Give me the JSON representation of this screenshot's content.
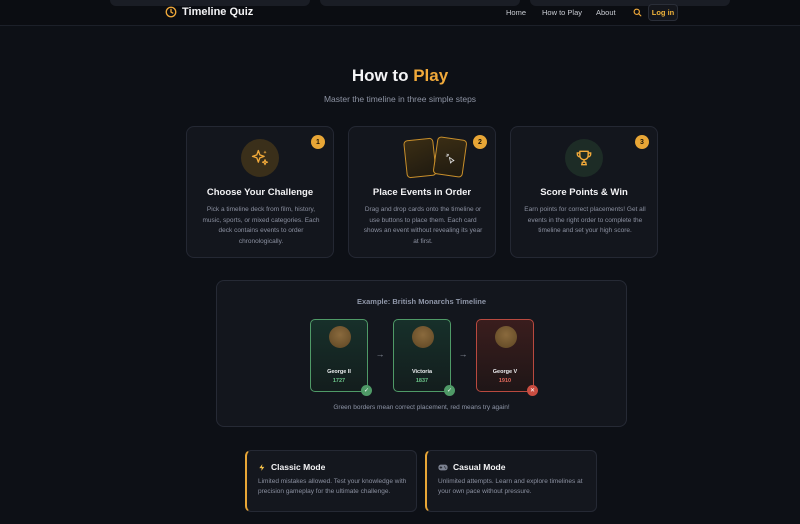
{
  "nav": {
    "brand": "Timeline Quiz",
    "links": [
      "Home",
      "How to Play",
      "About"
    ],
    "login": "Log in"
  },
  "hero": {
    "title_part1": "How to",
    "title_part2": "Play",
    "subtitle": "Master the timeline in three simple steps"
  },
  "steps": [
    {
      "number": "1",
      "icon": "sparkles-icon",
      "title": "Choose Your Challenge",
      "description": "Pick a timeline deck from film, history, music, sports, or mixed categories. Each deck contains events to order chronologically."
    },
    {
      "number": "2",
      "icon": "cards-icon",
      "title": "Place Events in Order",
      "description": "Drag and drop cards onto the timeline or use buttons to place them. Each card shows an event without revealing its year at first."
    },
    {
      "number": "3",
      "icon": "trophy-icon",
      "title": "Score Points & Win",
      "description": "Earn points for correct placements! Get all events in the right order to complete the timeline and set your high score."
    }
  ],
  "example": {
    "title": "Example: British Monarchs Timeline",
    "cards": [
      {
        "name": "George II",
        "year": "1727",
        "status": "correct",
        "badge": "✓"
      },
      {
        "name": "Victoria",
        "year": "1837",
        "status": "correct",
        "badge": "✓"
      },
      {
        "name": "George V",
        "year": "1910",
        "status": "incorrect",
        "badge": "✕"
      }
    ],
    "caption": "Green borders mean correct placement, red means try again!"
  },
  "modes": [
    {
      "icon": "lightning-icon",
      "title": "Classic Mode",
      "description": "Limited mistakes allowed. Test your knowledge with precision gameplay for the ultimate challenge."
    },
    {
      "icon": "gamepad-icon",
      "title": "Casual Mode",
      "description": "Unlimited attempts. Learn and explore timelines at your own pace without pressure."
    }
  ],
  "colors": {
    "accent": "#f0a93a",
    "correct": "#4f9a67",
    "incorrect": "#c94d41",
    "background": "#0d1016"
  }
}
